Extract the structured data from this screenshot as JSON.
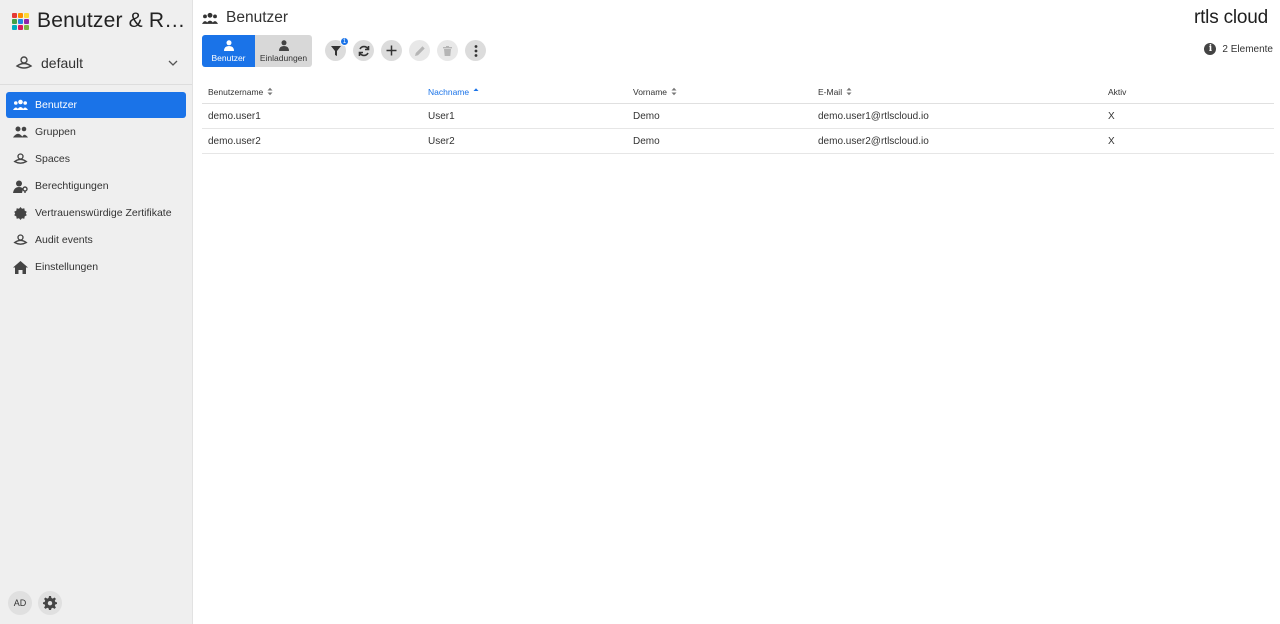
{
  "app": {
    "title": "Benutzer & Re..."
  },
  "space_selector": {
    "value": "default"
  },
  "sidebar": {
    "items": [
      {
        "label": "Benutzer",
        "icon": "users-icon",
        "active": true
      },
      {
        "label": "Gruppen",
        "icon": "group-icon",
        "active": false
      },
      {
        "label": "Spaces",
        "icon": "spaces-icon",
        "active": false
      },
      {
        "label": "Berechtigungen",
        "icon": "key-user-icon",
        "active": false
      },
      {
        "label": "Vertrauenswürdige Zertifikate",
        "icon": "certificate-icon",
        "active": false
      },
      {
        "label": "Audit events",
        "icon": "audit-icon",
        "active": false
      },
      {
        "label": "Einstellungen",
        "icon": "home-icon",
        "active": false
      }
    ],
    "avatar": "AD"
  },
  "header": {
    "title": "Benutzer",
    "brand": "rtls cloud",
    "count_text": "2 Elemente"
  },
  "toolbar": {
    "toggle_users": "Benutzer",
    "toggle_invitations": "Einladungen",
    "filter_badge": "1",
    "tools": [
      "filter-icon",
      "refresh-icon",
      "add-icon",
      "edit-icon",
      "delete-icon",
      "more-icon"
    ]
  },
  "table": {
    "columns": [
      {
        "label": "Benutzername",
        "sort": "none"
      },
      {
        "label": "Nachname",
        "sort": "asc"
      },
      {
        "label": "Vorname",
        "sort": "none"
      },
      {
        "label": "E-Mail",
        "sort": "none"
      },
      {
        "label": "Aktiv",
        "sort": null
      }
    ],
    "rows": [
      [
        "demo.user1",
        "User1",
        "Demo",
        "demo.user1@rtlscloud.io",
        "X"
      ],
      [
        "demo.user2",
        "User2",
        "Demo",
        "demo.user2@rtlscloud.io",
        "X"
      ]
    ]
  },
  "colors": {
    "accent": "#1a73e8",
    "sidebar_bg": "#efefef",
    "logo_grid": [
      "#e53935",
      "#fb8c00",
      "#fdd835",
      "#43a047",
      "#1e88e5",
      "#8e24aa",
      "#00acc1",
      "#d81b60",
      "#7cb342"
    ]
  }
}
